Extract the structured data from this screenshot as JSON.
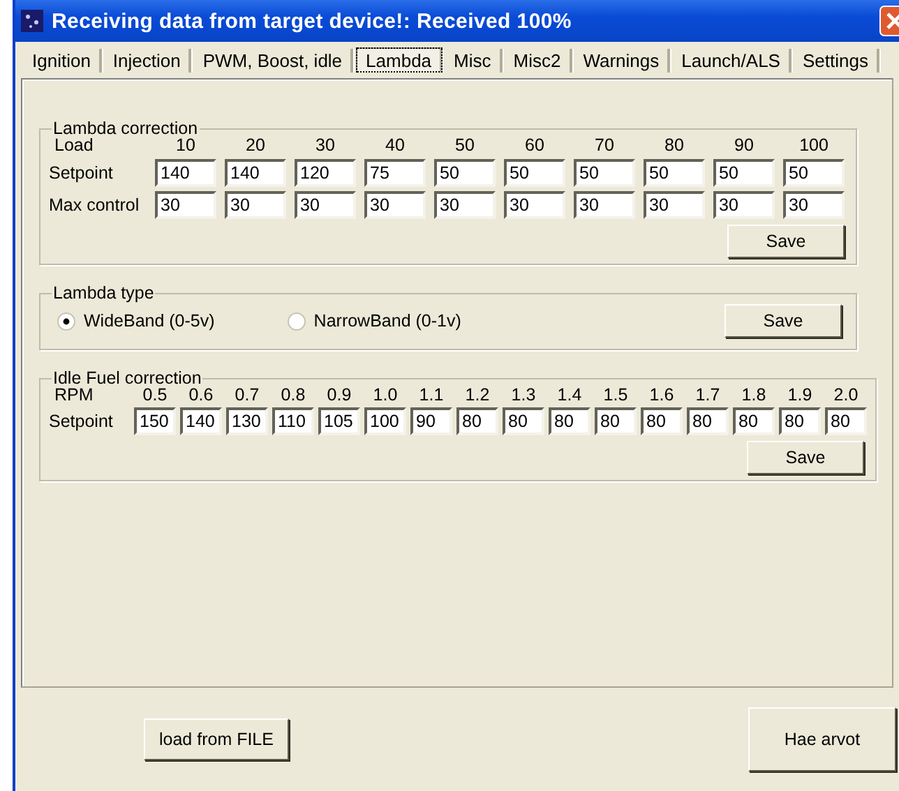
{
  "window": {
    "title": "Receiving data from target device!:  Received 100%"
  },
  "tabs": [
    {
      "label": "Ignition",
      "selected": false
    },
    {
      "label": "Injection",
      "selected": false
    },
    {
      "label": "PWM, Boost, idle",
      "selected": false
    },
    {
      "label": "Lambda",
      "selected": true
    },
    {
      "label": "Misc",
      "selected": false
    },
    {
      "label": "Misc2",
      "selected": false
    },
    {
      "label": "Warnings",
      "selected": false
    },
    {
      "label": "Launch/ALS",
      "selected": false
    },
    {
      "label": "Settings",
      "selected": false
    }
  ],
  "lambda_correction": {
    "title": "Lambda correction",
    "header_label": "Load",
    "columns": [
      "10",
      "20",
      "30",
      "40",
      "50",
      "60",
      "70",
      "80",
      "90",
      "100"
    ],
    "rows": [
      {
        "label": "Setpoint",
        "values": [
          "140",
          "140",
          "120",
          "75",
          "50",
          "50",
          "50",
          "50",
          "50",
          "50"
        ]
      },
      {
        "label": "Max control",
        "values": [
          "30",
          "30",
          "30",
          "30",
          "30",
          "30",
          "30",
          "30",
          "30",
          "30"
        ]
      }
    ],
    "button": "Save"
  },
  "lambda_type": {
    "title": "Lambda type",
    "options": [
      {
        "label": "WideBand (0-5v)",
        "selected": true
      },
      {
        "label": "NarrowBand (0-1v)",
        "selected": false
      }
    ],
    "button": "Save"
  },
  "idle_fuel_correction": {
    "title": "Idle Fuel correction",
    "header_label": "RPM",
    "columns": [
      "0.5",
      "0.6",
      "0.7",
      "0.8",
      "0.9",
      "1.0",
      "1.1",
      "1.2",
      "1.3",
      "1.4",
      "1.5",
      "1.6",
      "1.7",
      "1.8",
      "1.9",
      "2.0"
    ],
    "rows": [
      {
        "label": "Setpoint",
        "values": [
          "150",
          "140",
          "130",
          "110",
          "105",
          "100",
          "90",
          "80",
          "80",
          "80",
          "80",
          "80",
          "80",
          "80",
          "80",
          "80"
        ]
      }
    ],
    "button": "Save"
  },
  "buttons": [
    "load from FILE",
    "Hae arvot"
  ]
}
